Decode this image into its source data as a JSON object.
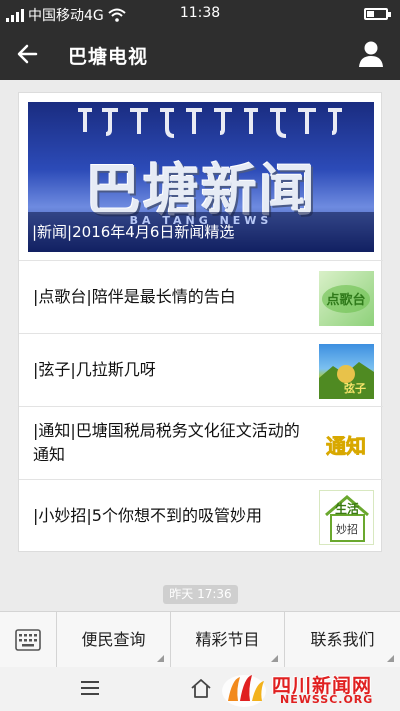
{
  "status_bar": {
    "carrier": "中国移动4G",
    "time": "11:38",
    "battery_level": 0.4,
    "icons": [
      "signal-icon",
      "wifi-icon",
      "battery-icon"
    ]
  },
  "header": {
    "title": "巴塘电视",
    "icons": [
      "back-arrow-icon",
      "person-icon"
    ]
  },
  "article_card": {
    "hero": {
      "image_title": "巴塘新闻",
      "image_subtitle": "BA TANG NEWS",
      "caption": "|新闻|2016年4月6日新闻精选"
    },
    "items": [
      {
        "title": "|点歌台|陪伴是最长情的告白",
        "thumb_text": "点歌台"
      },
      {
        "title": "|弦子|几拉斯几呀",
        "thumb_text": "弦子"
      },
      {
        "title": "|通知|巴塘国税局税务文化征文活动的通知",
        "thumb_text": "通知"
      },
      {
        "title": "|小妙招|5个你想不到的吸管妙用",
        "thumb_text": "生活",
        "thumb_subtext": "妙招"
      }
    ]
  },
  "timestamp": "昨天 17:36",
  "bottom_menu": {
    "items": [
      "便民查询",
      "精彩节目",
      "联系我们"
    ],
    "icons": [
      "keyboard-icon"
    ]
  },
  "nav_bar": {
    "icons": [
      "menu-icon",
      "home-icon"
    ],
    "watermark": {
      "text": "四川新闻网",
      "url": "NEWSSC.ORG"
    }
  },
  "colors": {
    "header_bg": "#2e2e2e",
    "page_bg": "#ebebeb",
    "watermark_red": "#e02020"
  }
}
